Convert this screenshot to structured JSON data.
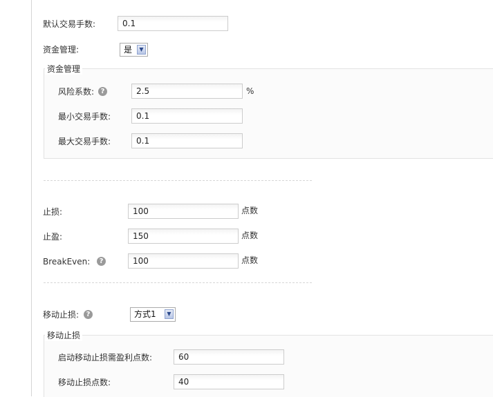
{
  "general": {
    "default_lots_label": "默认交易手数:",
    "default_lots_value": "0.1",
    "money_mgmt_label": "资金管理:",
    "money_mgmt_value": "是"
  },
  "money_mgmt_group": {
    "legend": "资金管理",
    "risk_label": "风险系数:",
    "risk_value": "2.5",
    "risk_unit": "%",
    "min_lots_label": "最小交易手数:",
    "min_lots_value": "0.1",
    "max_lots_label": "最大交易手数:",
    "max_lots_value": "0.1"
  },
  "stops": {
    "stop_loss_label": "止损:",
    "stop_loss_value": "100",
    "take_profit_label": "止盈:",
    "take_profit_value": "150",
    "break_even_label": "BreakEven:",
    "break_even_value": "100",
    "unit": "点数"
  },
  "trailing": {
    "label": "移动止损:",
    "mode_value": "方式1",
    "legend": "移动止损",
    "start_label": "启动移动止损需盈利点数:",
    "start_value": "60",
    "points_label": "移动止损点数:",
    "points_value": "40"
  },
  "icons": {
    "help": "?",
    "chevron": "▼"
  }
}
